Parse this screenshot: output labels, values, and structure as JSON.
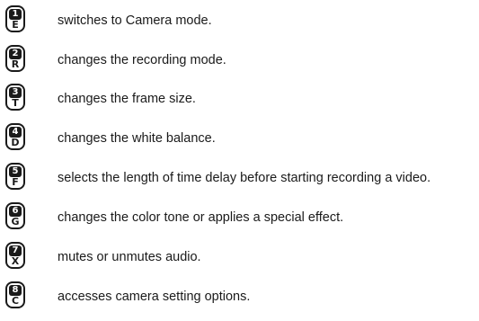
{
  "shortcuts": [
    {
      "number": "1",
      "key": "E",
      "icon": "key-1-e-icon",
      "description": "switches to Camera mode."
    },
    {
      "number": "2",
      "key": "R",
      "icon": "key-2-r-icon",
      "description": "changes the recording mode."
    },
    {
      "number": "3",
      "key": "T",
      "icon": "key-3-t-icon",
      "description": "changes the frame size."
    },
    {
      "number": "4",
      "key": "D",
      "icon": "key-4-d-icon",
      "description": "changes the white balance."
    },
    {
      "number": "5",
      "key": "F",
      "icon": "key-5-f-icon",
      "description": "selects the length of time delay before starting recording a video."
    },
    {
      "number": "6",
      "key": "G",
      "icon": "key-6-g-icon",
      "description": "changes the color tone or applies a special effect."
    },
    {
      "number": "7",
      "key": "X",
      "icon": "key-7-x-icon",
      "description": "mutes or unmutes audio."
    },
    {
      "number": "8",
      "key": "C",
      "icon": "key-8-c-icon",
      "description": "accesses camera setting options."
    }
  ]
}
